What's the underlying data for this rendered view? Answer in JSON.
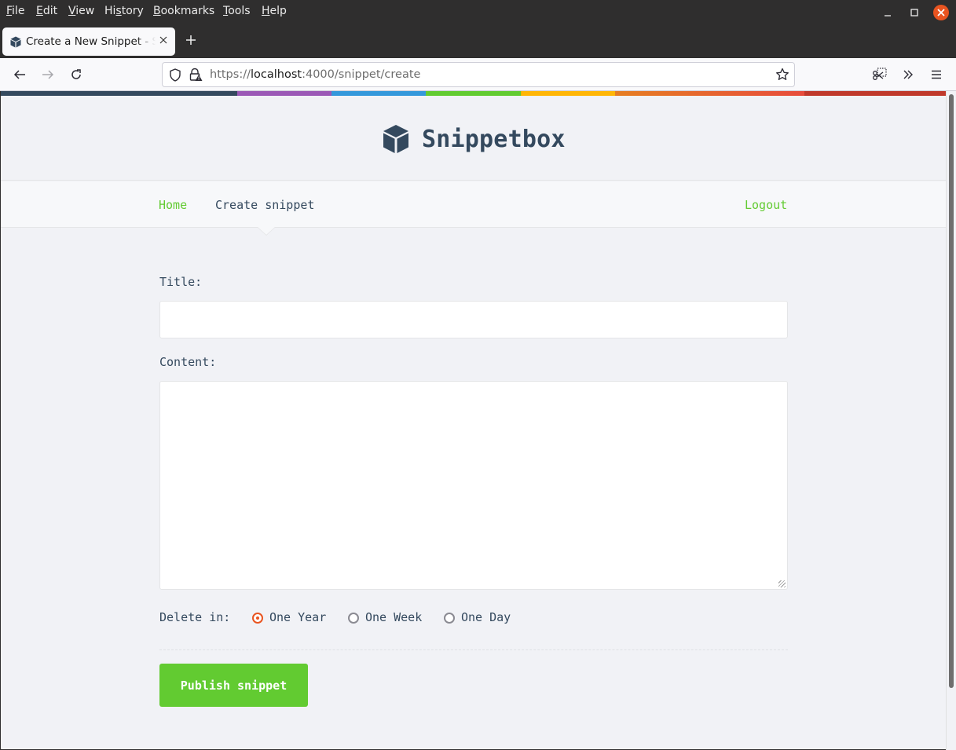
{
  "menubar": {
    "items": [
      {
        "label": "File",
        "accel": "F"
      },
      {
        "label": "Edit",
        "accel": "E"
      },
      {
        "label": "View",
        "accel": "V"
      },
      {
        "label": "History",
        "accel": "s"
      },
      {
        "label": "Bookmarks",
        "accel": "B"
      },
      {
        "label": "Tools",
        "accel": "T"
      },
      {
        "label": "Help",
        "accel": "H"
      }
    ]
  },
  "browser": {
    "tab_title": "Create a New Snippet - Snippetbox",
    "url_prefix": "https://",
    "url_host": "localhost",
    "url_rest": ":4000/snippet/create",
    "accent_close_color": "#e95420"
  },
  "colorbar": [
    "#34495e",
    "#9b59b6",
    "#3498db",
    "#62cb31",
    "#ffb606",
    "#e67e22",
    "#c0392b"
  ],
  "site": {
    "brand": "Snippetbox",
    "nav": {
      "home": "Home",
      "create": "Create snippet",
      "logout": "Logout"
    }
  },
  "form": {
    "title_label": "Title:",
    "title_value": "",
    "content_label": "Content:",
    "content_value": "",
    "delete_label": "Delete in:",
    "expires_options": [
      {
        "label": "One Year",
        "checked": true
      },
      {
        "label": "One Week",
        "checked": false
      },
      {
        "label": "One Day",
        "checked": false
      }
    ],
    "submit_label": "Publish snippet"
  }
}
